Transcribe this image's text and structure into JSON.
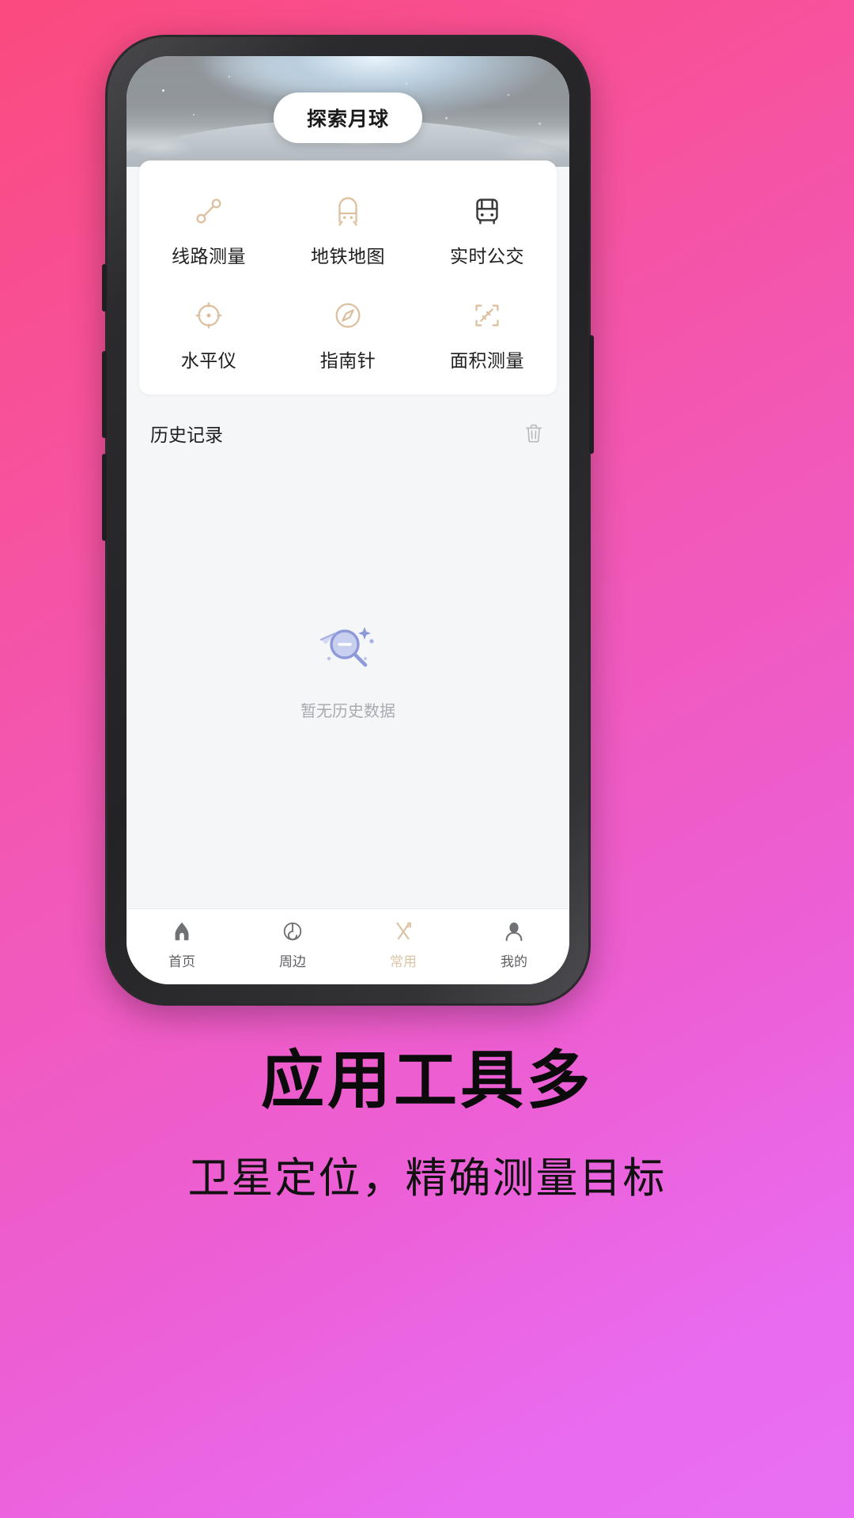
{
  "app": {
    "header_title": "探索月球"
  },
  "tools": {
    "items": [
      {
        "label": "线路测量",
        "icon": "route-measure-icon"
      },
      {
        "label": "地铁地图",
        "icon": "subway-map-icon"
      },
      {
        "label": "实时公交",
        "icon": "realtime-bus-icon"
      },
      {
        "label": "水平仪",
        "icon": "level-meter-icon"
      },
      {
        "label": "指南针",
        "icon": "compass-icon"
      },
      {
        "label": "面积测量",
        "icon": "area-measure-icon"
      }
    ]
  },
  "history": {
    "title": "历史记录",
    "clear_icon": "trash-icon",
    "empty_text": "暂无历史数据",
    "empty_icon": "magnifier-empty-icon"
  },
  "bottom_nav": {
    "items": [
      {
        "label": "首页",
        "icon": "home-icon",
        "active": false
      },
      {
        "label": "周边",
        "icon": "radar-icon",
        "active": false
      },
      {
        "label": "常用",
        "icon": "tools-icon",
        "active": true
      },
      {
        "label": "我的",
        "icon": "person-icon",
        "active": false
      }
    ]
  },
  "promo": {
    "headline": "应用工具多",
    "subline": "卫星定位，精确测量目标"
  },
  "colors": {
    "accent_tan": "#dcc5a6",
    "background_start": "#fb4a7e",
    "background_end": "#e86ff3",
    "text_dark": "#1e1e1e",
    "muted": "#a9abb0",
    "empty_icon": "#9aa4dd"
  }
}
